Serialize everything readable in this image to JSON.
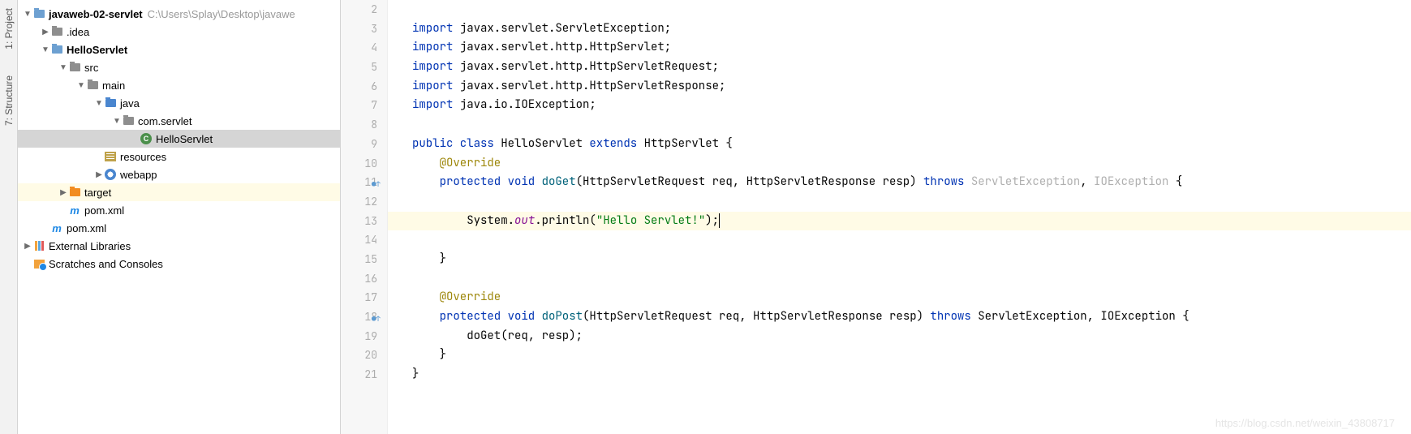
{
  "sidebar_tabs": {
    "project": "1: Project",
    "structure": "7: Structure"
  },
  "tree": {
    "root": {
      "name": "javaweb-02-servlet",
      "suffix": "C:\\Users\\Splay\\Desktop\\javawe"
    },
    "idea": ".idea",
    "module": "HelloServlet",
    "src": "src",
    "main": "main",
    "java": "java",
    "pkg": "com.servlet",
    "cls": "HelloServlet",
    "resources": "resources",
    "webapp": "webapp",
    "target": "target",
    "pom_inner": "pom.xml",
    "pom_outer": "pom.xml",
    "ext_libs": "External Libraries",
    "scratches": "Scratches and Consoles"
  },
  "editor": {
    "lines": [
      {
        "n": 2,
        "segs": []
      },
      {
        "n": 3,
        "segs": [
          {
            "c": "kw",
            "t": "import "
          },
          {
            "t": "javax.servlet.ServletException;"
          }
        ]
      },
      {
        "n": 4,
        "segs": [
          {
            "c": "kw",
            "t": "import "
          },
          {
            "t": "javax.servlet.http.HttpServlet;"
          }
        ]
      },
      {
        "n": 5,
        "segs": [
          {
            "c": "kw",
            "t": "import "
          },
          {
            "t": "javax.servlet.http.HttpServletRequest;"
          }
        ]
      },
      {
        "n": 6,
        "segs": [
          {
            "c": "kw",
            "t": "import "
          },
          {
            "t": "javax.servlet.http.HttpServletResponse;"
          }
        ]
      },
      {
        "n": 7,
        "segs": [
          {
            "c": "kw",
            "t": "import "
          },
          {
            "t": "java.io.IOException;"
          }
        ]
      },
      {
        "n": 8,
        "segs": []
      },
      {
        "n": 9,
        "segs": [
          {
            "c": "kw",
            "t": "public class "
          },
          {
            "t": "HelloServlet "
          },
          {
            "c": "kw",
            "t": "extends "
          },
          {
            "t": "HttpServlet {"
          }
        ]
      },
      {
        "n": 10,
        "indent": 1,
        "segs": [
          {
            "c": "ann",
            "t": "@Override"
          }
        ]
      },
      {
        "n": 11,
        "indent": 1,
        "mark": "●↑",
        "segs": [
          {
            "c": "kw",
            "t": "protected void "
          },
          {
            "c": "fn",
            "t": "doGet"
          },
          {
            "t": "(HttpServletRequest req, HttpServletResponse resp) "
          },
          {
            "c": "kw",
            "t": "throws "
          },
          {
            "c": "dim",
            "t": "ServletException"
          },
          {
            "t": ", "
          },
          {
            "c": "dim",
            "t": "IOException"
          },
          {
            "t": " {"
          }
        ]
      },
      {
        "n": 12,
        "segs": []
      },
      {
        "n": 13,
        "indent": 2,
        "hl": true,
        "segs": [
          {
            "t": "System."
          },
          {
            "c": "stat",
            "t": "out"
          },
          {
            "t": ".println("
          },
          {
            "c": "str",
            "t": "\"Hello Servlet!\""
          },
          {
            "t": ");"
          }
        ],
        "caret": true
      },
      {
        "n": 14,
        "segs": []
      },
      {
        "n": 15,
        "indent": 1,
        "segs": [
          {
            "t": "}"
          }
        ]
      },
      {
        "n": 16,
        "segs": []
      },
      {
        "n": 17,
        "indent": 1,
        "segs": [
          {
            "c": "ann",
            "t": "@Override"
          }
        ]
      },
      {
        "n": 18,
        "indent": 1,
        "mark": "●↑",
        "segs": [
          {
            "c": "kw",
            "t": "protected void "
          },
          {
            "c": "fn",
            "t": "doPost"
          },
          {
            "t": "(HttpServletRequest req, HttpServletResponse resp) "
          },
          {
            "c": "kw",
            "t": "throws "
          },
          {
            "t": "ServletException, IOException {"
          }
        ]
      },
      {
        "n": 19,
        "indent": 2,
        "segs": [
          {
            "t": "doGet(req, resp);"
          }
        ]
      },
      {
        "n": 20,
        "indent": 1,
        "segs": [
          {
            "t": "}"
          }
        ]
      },
      {
        "n": 21,
        "segs": [
          {
            "t": "}"
          }
        ]
      }
    ]
  },
  "watermark": "https://blog.csdn.net/weixin_43808717"
}
